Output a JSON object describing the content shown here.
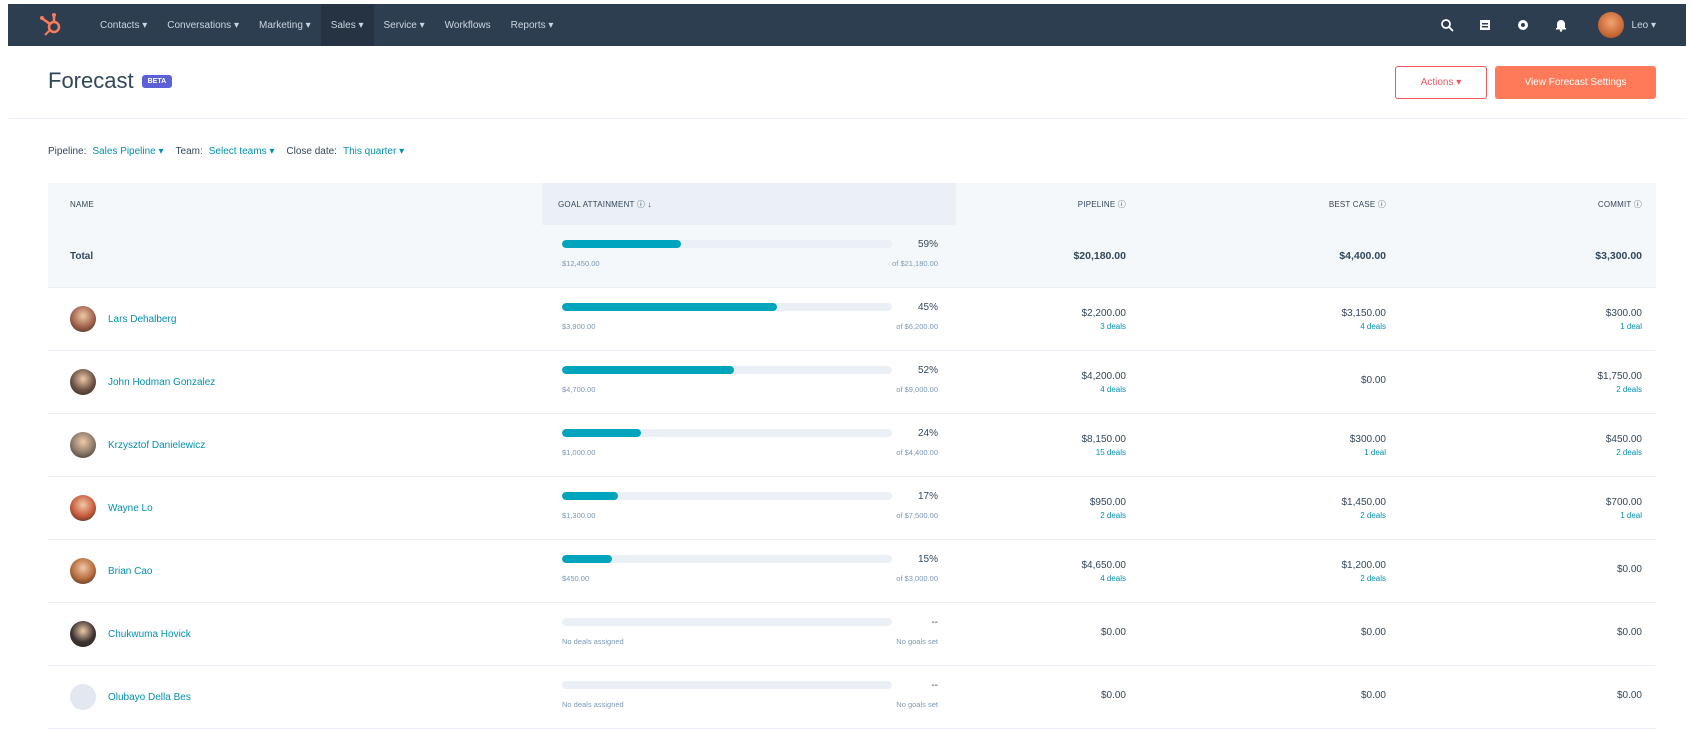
{
  "nav": {
    "items": [
      "Contacts ▾",
      "Conversations ▾",
      "Marketing ▾",
      "Sales ▾",
      "Service ▾",
      "Workflows",
      "Reports ▾"
    ],
    "user": "Leo ▾"
  },
  "header": {
    "title": "Forecast",
    "badge": "BETA",
    "actions_label": "Actions ▾",
    "settings_label": "View Forecast Settings"
  },
  "filters": {
    "pipeline_label": "Pipeline:",
    "pipeline_value": "Sales Pipeline ▾",
    "team_label": "Team:",
    "team_value": "Select teams ▾",
    "close_label": "Close date:",
    "close_value": "This quarter ▾"
  },
  "table": {
    "headers": {
      "name": "NAME",
      "goal": "GOAL ATTAINMENT ⓘ ↓",
      "pipeline": "PIPELINE ⓘ",
      "bestcase": "BEST CASE ⓘ",
      "commit": "COMMIT ⓘ"
    },
    "total": {
      "label": "Total",
      "pct": "59%",
      "achieved": "$12,450.00",
      "goal": "of $21,180.00",
      "progress": 0.36,
      "pipeline": "$20,180.00",
      "bestcase": "$4,400.00",
      "commit": "$3,300.00"
    },
    "rows": [
      {
        "name": "Lars Dehalberg",
        "pct": "45%",
        "achieved": "$3,900.00",
        "goal": "of $6,200.00",
        "progress": 0.65,
        "pipeline": "$2,200.00",
        "pipeline_deals": "3 deals",
        "bestcase": "$3,150.00",
        "bestcase_deals": "4 deals",
        "commit": "$300.00",
        "commit_deals": "1 deal",
        "avatar_color": "#a0614a"
      },
      {
        "name": "John Hodman Gonzalez",
        "pct": "52%",
        "achieved": "$4,700.00",
        "goal": "of $9,000.00",
        "progress": 0.52,
        "pipeline": "$4,200.00",
        "pipeline_deals": "4 deals",
        "bestcase": "$0.00",
        "bestcase_deals": "",
        "commit": "$1,750.00",
        "commit_deals": "2 deals",
        "avatar_color": "#6b5144"
      },
      {
        "name": "Krzysztof Danielewicz",
        "pct": "24%",
        "achieved": "$1,000.00",
        "goal": "of $4,400.00",
        "progress": 0.24,
        "pipeline": "$8,150.00",
        "pipeline_deals": "15 deals",
        "bestcase": "$300.00",
        "bestcase_deals": "1 deal",
        "commit": "$450.00",
        "commit_deals": "2 deals",
        "avatar_color": "#8a7868"
      },
      {
        "name": "Wayne Lo",
        "pct": "17%",
        "achieved": "$1,300.00",
        "goal": "of $7,500.00",
        "progress": 0.17,
        "pipeline": "$950.00",
        "pipeline_deals": "2 deals",
        "bestcase": "$1,450.00",
        "bestcase_deals": "2 deals",
        "commit": "$700.00",
        "commit_deals": "1 deal",
        "avatar_color": "#c75a3a"
      },
      {
        "name": "Brian Cao",
        "pct": "15%",
        "achieved": "$450.00",
        "goal": "of $3,000.00",
        "progress": 0.15,
        "pipeline": "$4,650.00",
        "pipeline_deals": "4 deals",
        "bestcase": "$1,200.00",
        "bestcase_deals": "2 deals",
        "commit": "$0.00",
        "commit_deals": "",
        "avatar_color": "#b56a3c"
      },
      {
        "name": "Chukwuma Hovick",
        "pct": "--",
        "achieved": "No deals assigned",
        "goal": "No goals set",
        "progress": 0,
        "pipeline": "$0.00",
        "pipeline_deals": "",
        "bestcase": "$0.00",
        "bestcase_deals": "",
        "commit": "$0.00",
        "commit_deals": "",
        "avatar_color": "#3d3431"
      },
      {
        "name": "Olubayo Della Bes",
        "pct": "--",
        "achieved": "No deals assigned",
        "goal": "No goals set",
        "progress": 0,
        "pipeline": "$0.00",
        "pipeline_deals": "",
        "bestcase": "$0.00",
        "bestcase_deals": "",
        "commit": "$0.00",
        "commit_deals": "",
        "avatar_color": "#e3e8f0"
      }
    ]
  },
  "colors": {
    "nav_bg": "#2d3e50",
    "accent": "#ff7a59",
    "link": "#0091ae",
    "bar": "#00a4bd"
  }
}
